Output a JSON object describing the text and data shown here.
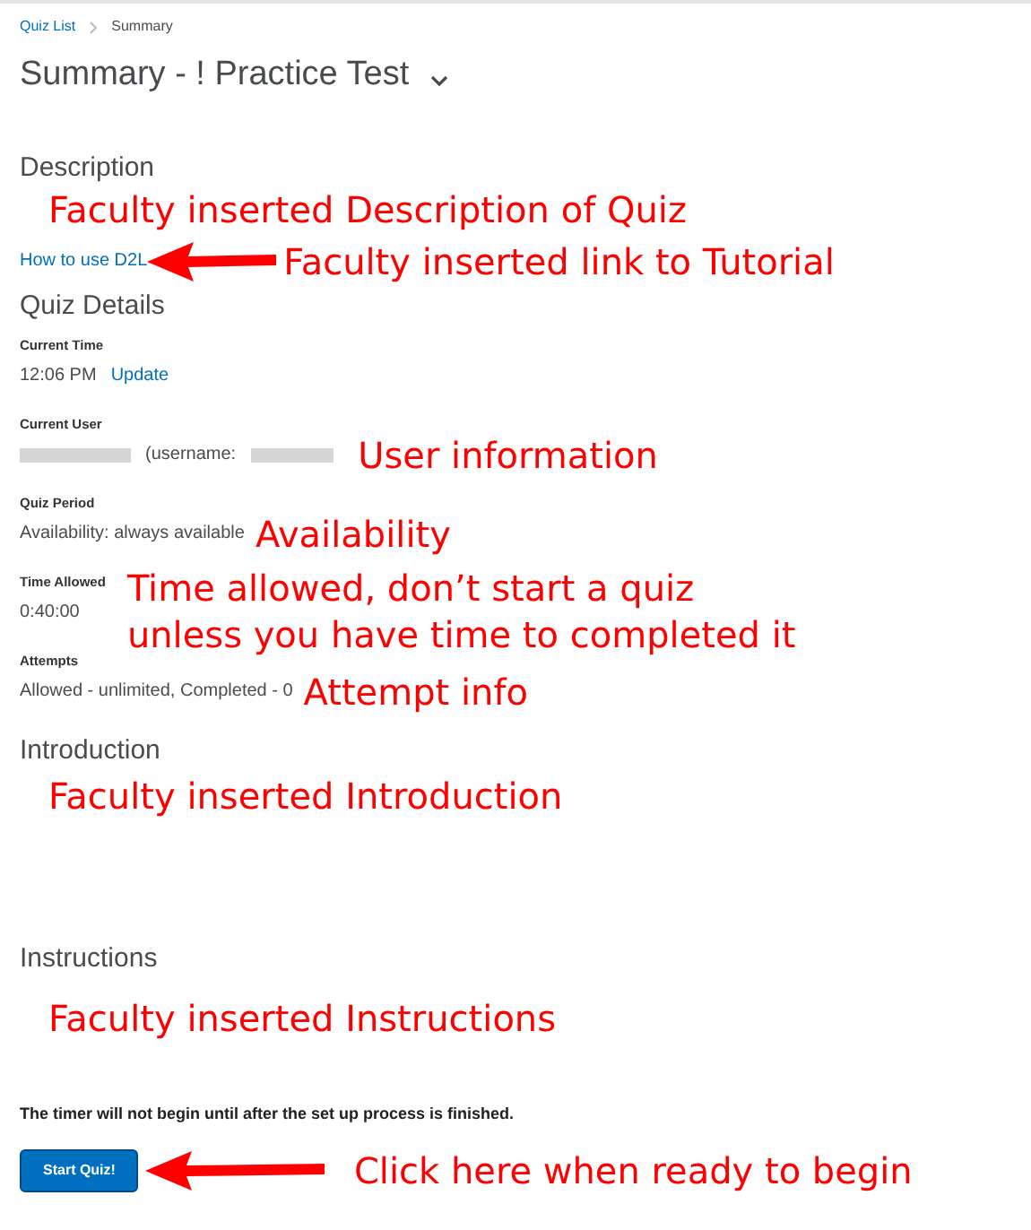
{
  "breadcrumbs": [
    {
      "label": "Quiz List",
      "link": true
    },
    {
      "label": "Summary",
      "link": false
    }
  ],
  "title": "Summary - ! Practice Test",
  "description": {
    "heading": "Description",
    "note": "Faculty inserted Description of Quiz",
    "link": "How to use D2L",
    "link_note": "Faculty inserted link to Tutorial"
  },
  "quiz_details": {
    "heading": "Quiz Details",
    "fields": [
      {
        "label": "Current Time",
        "value": "12:06 PM",
        "action": "Update",
        "redacted": false
      },
      {
        "label": "Current User",
        "value": "(username:",
        "redacted": true,
        "notes": [
          "User information"
        ]
      },
      {
        "label": "Quiz Period",
        "value": "Availability: always available",
        "redacted": false,
        "notes": [
          "Availability"
        ]
      },
      {
        "label": "Time Allowed",
        "value": "0:40:00",
        "redacted": false,
        "notes": [
          "Time allowed, don’t start a quiz",
          "unless you have time to completed it"
        ]
      },
      {
        "label": "Attempts",
        "value": "Allowed - unlimited, Completed - 0",
        "redacted": false,
        "notes": [
          "Attempt info"
        ]
      }
    ]
  },
  "introduction": {
    "heading": "Introduction",
    "note": "Faculty inserted Introduction"
  },
  "instructions": {
    "heading": "Instructions",
    "note": "Faculty inserted Instructions"
  },
  "timer_notice": "The timer will not begin until after the set up process is finished.",
  "start_button": {
    "label": "Start Quiz!",
    "note": "Click here when ready to begin"
  }
}
